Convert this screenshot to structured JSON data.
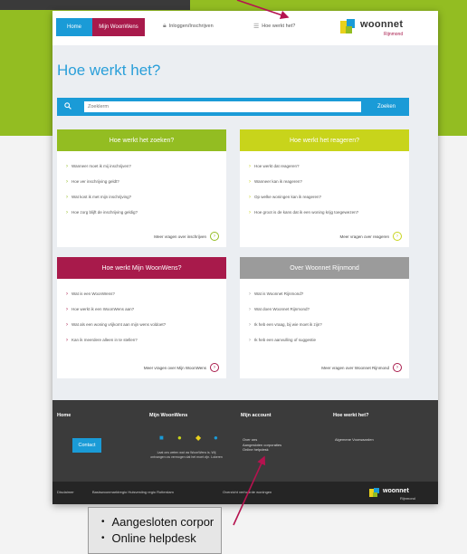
{
  "colors": {
    "accent_blue": "#1a9bd7",
    "brand_green": "#93bd22",
    "brand_magenta": "#a81a4b",
    "brand_yellow": "#c8d41b",
    "grey": "#9b9b9b",
    "arrow": "#b5134f"
  },
  "topbar": {
    "tabs": [
      {
        "label": "Home"
      },
      {
        "label": "Mijn WoonWens"
      }
    ],
    "links": [
      {
        "label": "Inloggen/Inschrijven",
        "icon": "lock-icon"
      },
      {
        "label": "Hoe werkt het?",
        "icon": "menu-icon"
      }
    ],
    "logo": {
      "name": "woonnet",
      "sub": "Rijnmond"
    }
  },
  "page_title": "Hoe werkt het?",
  "search": {
    "placeholder": "Zoeklerm",
    "button": "Zoeken"
  },
  "cards": [
    {
      "title": "Hoe werkt het zoeken?",
      "items": [
        "Wanneer moet ik mij inschrijven?",
        "Hoe ver inschrijving geldt?",
        "Wat kost ik met mijn inschrijving?",
        "Hoe zorg blijft de inschrijving geldig?"
      ],
      "more": "Meer vragen over inschrijven"
    },
    {
      "title": "Hoe werkt het reageren?",
      "items": [
        "Hoe werkt dat reageren?",
        "Wanneer kan ik reageren?",
        "Op welke woningen kan ik reageren?",
        "Hoe groot is de kans dat ik een woning krijg toegewezen?"
      ],
      "more": "Meer vragen over reageren"
    },
    {
      "title": "Hoe werkt Mijn WoonWens?",
      "items": [
        "Wat is een WoonWens?",
        "Hoe werkt ik een WoonWens aan?",
        "Wat als een woning vrijkomt aan mijn wens voldoet?",
        "Kan ik meerdere alleen in te stellen?"
      ],
      "more": "Meer vragen over Mijn WoonWens"
    },
    {
      "title": "Over Woonnet Rijnmond",
      "items": [
        "Wat is Woonnet Rijnmond?",
        "Wat doen Woonnet Rijnmond?",
        "Ik heb een vraag, bij wie moet ik zijn?",
        "Ik heb een aanvulling of suggestie"
      ],
      "more": "Meer vragen over Woonnet Rijnmond"
    }
  ],
  "footer": {
    "columns": [
      {
        "title": "Home"
      },
      {
        "title": "Mijn WoonWens"
      },
      {
        "title": "Mijn account"
      },
      {
        "title": "Hoe werkt het?"
      }
    ],
    "contact_button": "Contact",
    "note": "Laat ons weten wat uw WoonWens is. Wij ontvangen uw vermogen dat het moet zijn. Lokeren",
    "account_items": [
      "Over ons",
      "Aangesloten corporaties",
      "Online helpdesk"
    ],
    "help_items": [
      "Algemene Voorwaarden"
    ],
    "bottom_links": [
      "Disclaimer",
      "Basiswoonmarktregio Huisvesting regio Rotterdam",
      "Overzicht verhuurde woningen"
    ],
    "bottom_logo": {
      "name": "woonnet",
      "sub": "Rijnmond"
    }
  },
  "zoom_callout": {
    "items": [
      "Aangesloten corpor",
      "Online helpdesk"
    ]
  }
}
